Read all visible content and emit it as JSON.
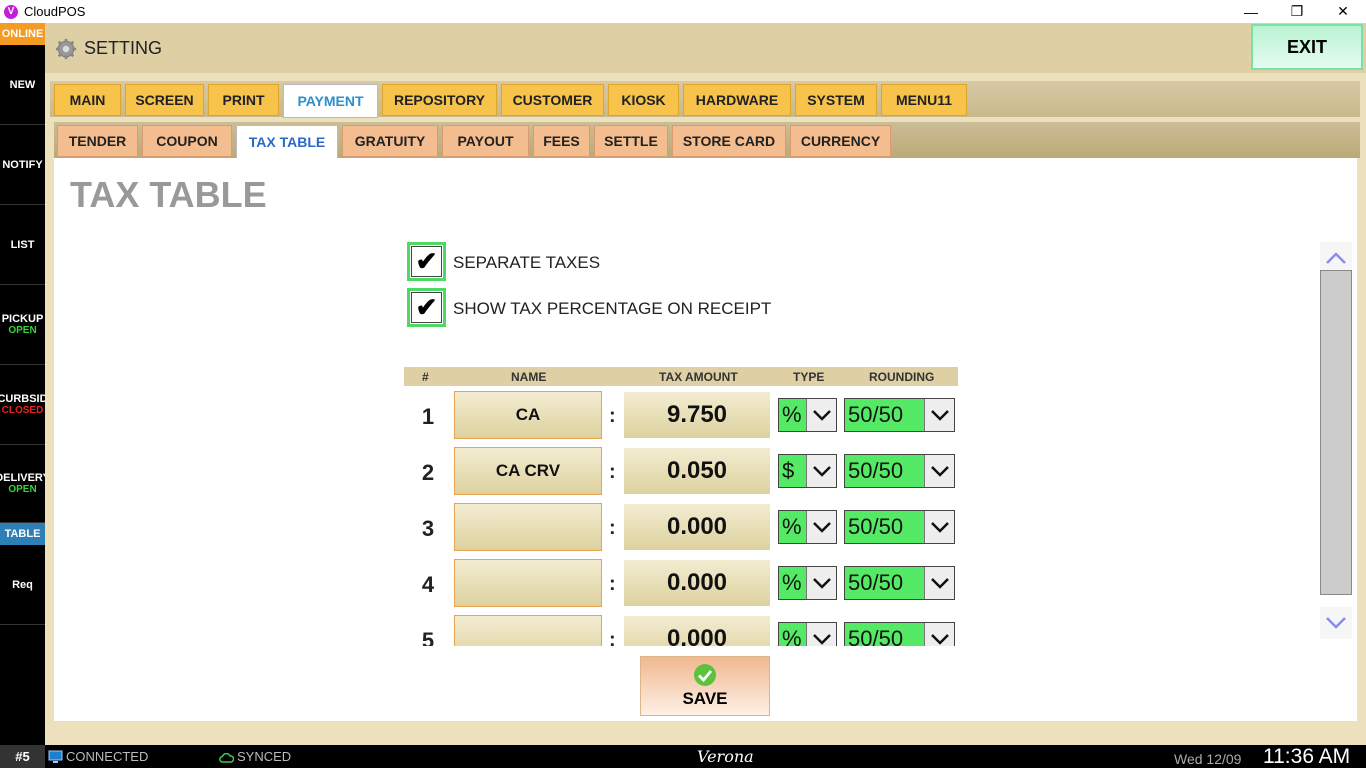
{
  "window": {
    "title": "CloudPOS",
    "logo_letter": "V",
    "minimize": "—",
    "restore": "❐",
    "close": "✕"
  },
  "sidebar": {
    "online": "ONLINE",
    "items": [
      {
        "label": "NEW",
        "sub": ""
      },
      {
        "label": "NOTIFY",
        "sub": ""
      },
      {
        "label": "LIST",
        "sub": ""
      },
      {
        "label": "PICKUP",
        "sub": "OPEN",
        "sub_color": "#3ad13a"
      },
      {
        "label": "CURBSID",
        "sub": "CLOSED",
        "sub_color": "#e52222"
      },
      {
        "label": "DELIVERY",
        "sub": "OPEN",
        "sub_color": "#3ad13a"
      },
      {
        "label": "Req",
        "sub": ""
      }
    ],
    "table": "TABLE"
  },
  "header": {
    "title": "SETTING",
    "exit": "EXIT"
  },
  "tabs_main": [
    "MAIN",
    "SCREEN",
    "PRINT",
    "PAYMENT",
    "REPOSITORY",
    "CUSTOMER",
    "KIOSK",
    "HARDWARE",
    "SYSTEM",
    "MENU11"
  ],
  "tabs_main_active": "PAYMENT",
  "tabs_sub": [
    "TENDER",
    "COUPON",
    "TAX TABLE",
    "GRATUITY",
    "PAYOUT",
    "FEES",
    "SETTLE",
    "STORE CARD",
    "CURRENCY"
  ],
  "tabs_sub_active": "TAX TABLE",
  "page": {
    "title": "TAX TABLE",
    "separate_taxes": {
      "label": "SEPARATE TAXES",
      "checked": true,
      "mark": "✔"
    },
    "show_pct": {
      "label": "SHOW TAX PERCENTAGE ON RECEIPT",
      "checked": true,
      "mark": "✔"
    }
  },
  "table": {
    "headers": {
      "num": "#",
      "name": "NAME",
      "amount": "TAX AMOUNT",
      "type": "TYPE",
      "rounding": "ROUNDING"
    },
    "colon": ":",
    "rows": [
      {
        "num": "1",
        "name": "CA",
        "amount": "9.750",
        "type": "%",
        "rounding": "50/50"
      },
      {
        "num": "2",
        "name": "CA CRV",
        "amount": "0.050",
        "type": "$",
        "rounding": "50/50"
      },
      {
        "num": "3",
        "name": "",
        "amount": "0.000",
        "type": "%",
        "rounding": "50/50"
      },
      {
        "num": "4",
        "name": "",
        "amount": "0.000",
        "type": "%",
        "rounding": "50/50"
      },
      {
        "num": "5",
        "name": "",
        "amount": "0.000",
        "type": "%",
        "rounding": "50/50"
      }
    ]
  },
  "save": {
    "label": "SAVE"
  },
  "status": {
    "station": "#5",
    "connected": "CONNECTED",
    "synced": "SYNCED",
    "store": "Verona",
    "date": "Wed 12/09",
    "time": "11:36 AM"
  }
}
